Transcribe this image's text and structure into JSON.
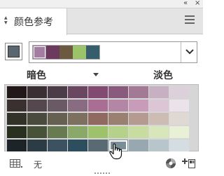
{
  "window": {
    "collapse_glyph": "«",
    "close_glyph": "×"
  },
  "tab": {
    "label": "颜色参考"
  },
  "icons": {
    "tab_arrows": "double-arrow-icon",
    "panel_menu": "hamburger-menu-icon",
    "harmony_dropdown": "chevron-down-icon",
    "variation_menu": "triangle-down-icon",
    "grid_view": "grid-view-icon",
    "color_wheel": "color-wheel-icon",
    "add_to_swatches": "add-swatch-icon"
  },
  "current_color": "#5a6770",
  "harmony_colors": [
    "#a47ea2",
    "#6b3a5e",
    "#6b5a40",
    "#9bc46a",
    "#365d6b"
  ],
  "variations": {
    "dark_label": "暗色",
    "light_label": "淡色"
  },
  "grid": {
    "rows": [
      [
        "#221818",
        "#3a3034",
        "#4c3c48",
        "#6a4660",
        "#824a70",
        "#8a5a7e",
        "#a27a96",
        "#c6b0c2",
        "#dcd0da"
      ],
      [
        "#3a3030",
        "#54484e",
        "#6a5a66",
        "#8a6c82",
        "#a86e94",
        "#b486a6",
        "#c89cb8",
        "#dcc6d6",
        "#ece2ea"
      ],
      [
        "#323228",
        "#4a4a3e",
        "#656052",
        "#7d7060",
        "#906a60",
        "#9a8070",
        "#b49a90",
        "#ccbcb4",
        "#e0d8d2"
      ],
      [
        "#2a3020",
        "#485238",
        "#687a52",
        "#8aa868",
        "#9ec26c",
        "#b6d28a",
        "#c8dca2",
        "#d8e6bc",
        "#e8f0d6"
      ],
      [
        "#1c2428",
        "#2c3c44",
        "#3c5260",
        "#2c4e5e",
        "#5a6a72",
        "#7a8e98",
        "#98a8b0",
        "#b8c6cc",
        "#d4dee2"
      ]
    ],
    "selected_row": 4,
    "selected_col": 5
  },
  "footer": {
    "none_label": "无"
  }
}
